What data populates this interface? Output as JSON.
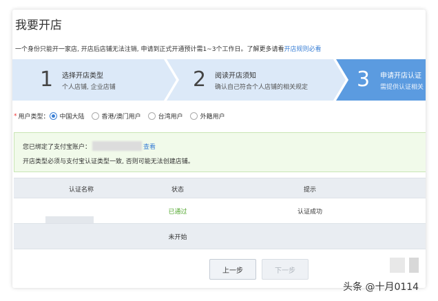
{
  "page": {
    "title": "我要开店",
    "notice_text": "一个身份只能开一家店, 开店后店铺无法注销, 申请到正式开通预计需1~3个工作日。了解更多请看",
    "notice_link": "开店规则必看"
  },
  "steps": [
    {
      "number": "1",
      "title": "选择开店类型",
      "desc": "个人店铺, 企业店铺",
      "active": false
    },
    {
      "number": "2",
      "title": "阅读开店须知",
      "desc": "确认自己符合个人店铺的相关规定",
      "active": false
    },
    {
      "number": "3",
      "title": "申请开店认证",
      "desc": "需提供认证相关",
      "active": true
    }
  ],
  "usertype": {
    "label": "用户类型：",
    "required_mark": "*",
    "options": [
      {
        "label": "中国大陆",
        "checked": true
      },
      {
        "label": "香港/澳门用户",
        "checked": false
      },
      {
        "label": "台湾用户",
        "checked": false
      },
      {
        "label": "外籍用户",
        "checked": false
      }
    ]
  },
  "alert": {
    "line1_prefix": "您已绑定了支付宝账户：",
    "line1_link": "查看",
    "line2": "开店类型必须与支付宝认证类型一致, 否则可能无法创建店铺。"
  },
  "table": {
    "headers": [
      "认证名称",
      "状态",
      "提示"
    ],
    "rows": [
      {
        "name": "",
        "status": "已通过",
        "tip": "认证成功"
      },
      {
        "name": "",
        "status": "未开始",
        "tip": ""
      }
    ]
  },
  "buttons": {
    "prev": "上一步",
    "next": "下一步"
  },
  "watermark": "头条 @十月0114",
  "colors": {
    "step_inactive": "#dce9f8",
    "step_active": "#5b9be0",
    "link": "#3a7fd5",
    "success": "#52a72e"
  }
}
